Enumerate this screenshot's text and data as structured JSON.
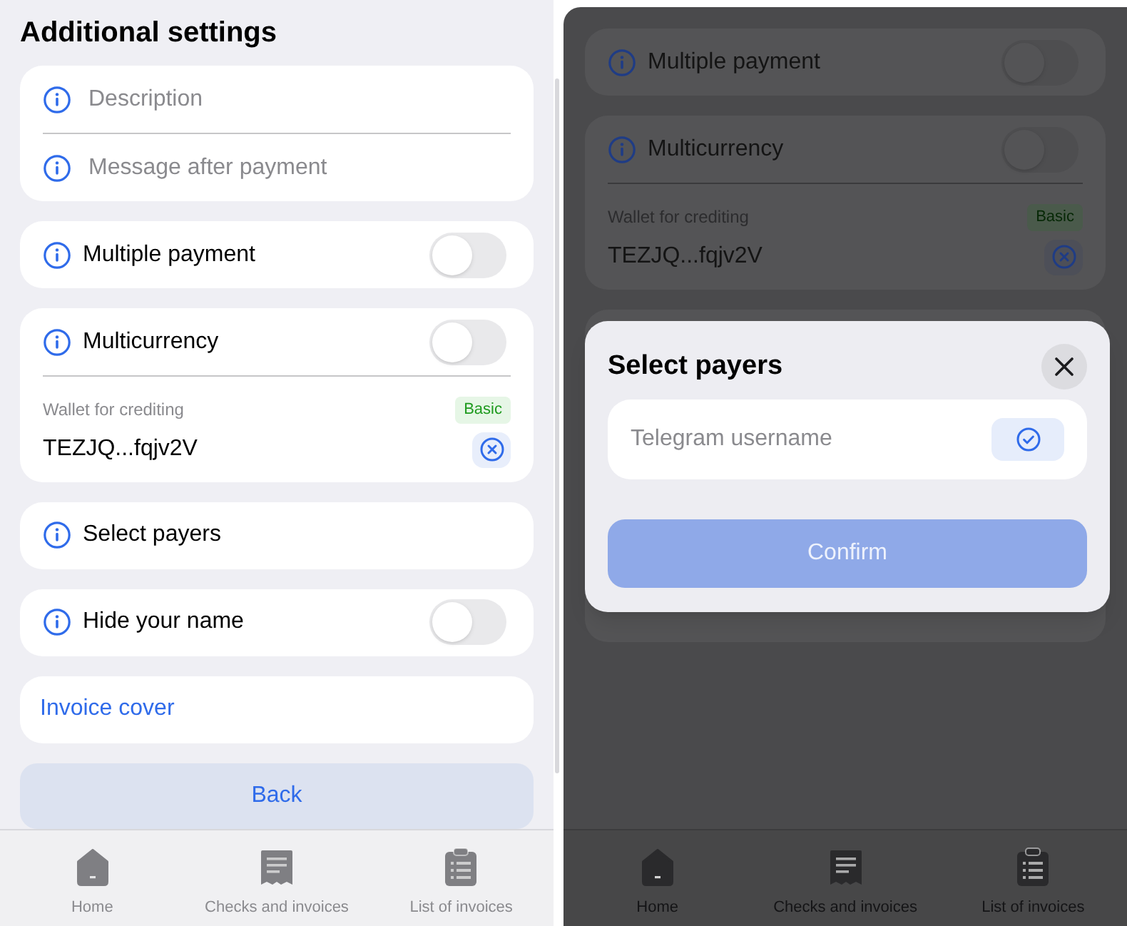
{
  "settings_screen": {
    "title": "Additional settings",
    "groups": [
      {
        "rows": [
          {
            "kind": "field",
            "placeholder": "Description"
          },
          {
            "kind": "field",
            "placeholder": "Message after payment"
          }
        ]
      },
      {
        "rows": [
          {
            "kind": "toggle",
            "label": "Multiple payment",
            "on": false
          }
        ]
      },
      {
        "rows": [
          {
            "kind": "toggle",
            "label": "Multicurrency",
            "on": false
          },
          {
            "kind": "wallet",
            "label": "Wallet for crediting",
            "badge": "Basic",
            "value": "TEZJQ...fqjv2V"
          }
        ]
      },
      {
        "rows": [
          {
            "kind": "option",
            "label": "Select payers"
          }
        ]
      },
      {
        "rows": [
          {
            "kind": "toggle",
            "label": "Hide your name",
            "on": false
          }
        ]
      },
      {
        "rows": [
          {
            "kind": "link",
            "label": "Invoice cover"
          }
        ]
      }
    ],
    "back_button": "Back",
    "bottom_nav": [
      {
        "label": "Home"
      },
      {
        "label": "Checks and invoices"
      },
      {
        "label": "List of invoices"
      }
    ]
  },
  "dialog_screen": {
    "groups": [
      {
        "rows": [
          {
            "kind": "toggle",
            "label": "Multiple payment",
            "on": false
          }
        ]
      },
      {
        "rows": [
          {
            "kind": "toggle",
            "label": "Multicurrency",
            "on": false
          },
          {
            "kind": "wallet",
            "label": "Wallet for crediting",
            "badge": "Basic",
            "value": "TEZJQ...fqjv2V"
          }
        ]
      }
    ],
    "modal": {
      "title": "Select payers",
      "field": {
        "placeholder": "Telegram username"
      },
      "confirm_button": {
        "label": "Confirm",
        "disabled": true
      }
    },
    "bottom_nav": [
      {
        "label": "Home"
      },
      {
        "label": "Checks and invoices"
      },
      {
        "label": "List of invoices"
      }
    ]
  }
}
